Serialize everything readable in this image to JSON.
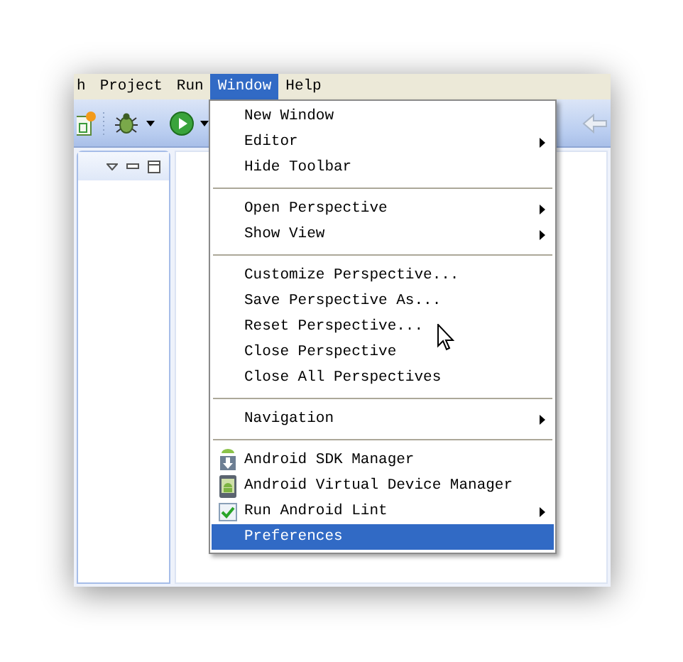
{
  "menubar": [
    {
      "label": "h",
      "selected": false
    },
    {
      "label": "Project",
      "selected": false
    },
    {
      "label": "Run",
      "selected": false
    },
    {
      "label": "Window",
      "selected": true
    },
    {
      "label": "Help",
      "selected": false
    }
  ],
  "menu": {
    "groups": [
      {
        "items": [
          {
            "kind": "plain",
            "label": "New Window",
            "submenu": false,
            "selected": false
          },
          {
            "kind": "plain",
            "label": "Editor",
            "submenu": true,
            "selected": false
          },
          {
            "kind": "plain",
            "label": "Hide Toolbar",
            "submenu": false,
            "selected": false
          }
        ]
      },
      {
        "items": [
          {
            "kind": "plain",
            "label": "Open Perspective",
            "submenu": true,
            "selected": false
          },
          {
            "kind": "plain",
            "label": "Show View",
            "submenu": true,
            "selected": false
          }
        ]
      },
      {
        "items": [
          {
            "kind": "plain",
            "label": "Customize Perspective...",
            "submenu": false,
            "selected": false
          },
          {
            "kind": "plain",
            "label": "Save Perspective As...",
            "submenu": false,
            "selected": false
          },
          {
            "kind": "plain",
            "label": "Reset Perspective...",
            "submenu": false,
            "selected": false
          },
          {
            "kind": "plain",
            "label": "Close Perspective",
            "submenu": false,
            "selected": false
          },
          {
            "kind": "plain",
            "label": "Close All Perspectives",
            "submenu": false,
            "selected": false
          }
        ]
      },
      {
        "items": [
          {
            "kind": "plain",
            "label": "Navigation",
            "submenu": true,
            "selected": false
          }
        ]
      },
      {
        "items": [
          {
            "kind": "download",
            "label": "Android SDK Manager",
            "submenu": false,
            "selected": false
          },
          {
            "kind": "device",
            "label": "Android Virtual Device Manager",
            "submenu": false,
            "selected": false
          },
          {
            "kind": "check",
            "label": "Run Android Lint",
            "submenu": true,
            "selected": false
          },
          {
            "kind": "plain",
            "label": "Preferences",
            "submenu": false,
            "selected": true
          }
        ]
      }
    ]
  }
}
